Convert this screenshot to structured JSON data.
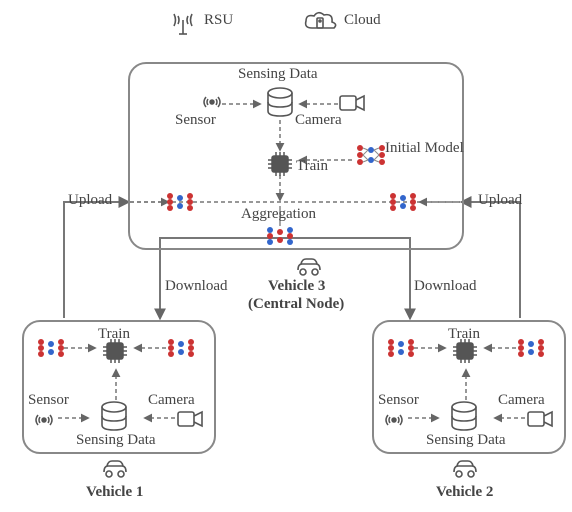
{
  "legend": {
    "rsu": "RSU",
    "cloud": "Cloud"
  },
  "central": {
    "sensing_data": "Sensing Data",
    "sensor": "Sensor",
    "camera": "Camera",
    "train": "Train",
    "aggregation": "Aggregation",
    "initial_model": "Initial Model",
    "vehicle_label": "Vehicle 3",
    "role": "(Central Node)"
  },
  "edges": {
    "upload_left": "Upload",
    "upload_right": "Upload",
    "download_left": "Download",
    "download_right": "Download"
  },
  "v1": {
    "train": "Train",
    "sensor": "Sensor",
    "camera": "Camera",
    "sensing_data": "Sensing Data",
    "label": "Vehicle 1"
  },
  "v2": {
    "train": "Train",
    "sensor": "Sensor",
    "camera": "Camera",
    "sensing_data": "Sensing Data",
    "label": "Vehicle 2"
  }
}
